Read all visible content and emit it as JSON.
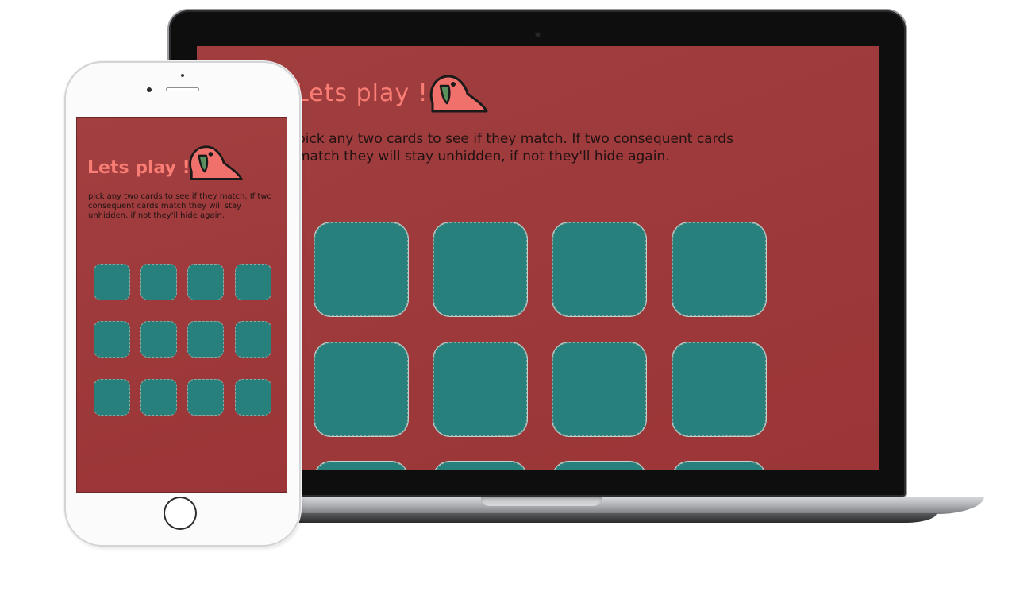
{
  "laptop": {
    "title": "Lets play !",
    "description": "pick any two cards to see if they match. If two consequent cards match they will stay unhidden, if not they'll hide again.",
    "cards_visible_rows": 3,
    "cards_per_row": 4
  },
  "phone": {
    "title": "Lets play !",
    "description": "pick any two cards to see if they match. If two consequent cards match they will stay unhidden, if not they'll hide again.",
    "cards_rows": 3,
    "cards_per_row": 4
  },
  "icons": {
    "mascot": "parrot-icon"
  },
  "colors": {
    "background": "#a03e3f",
    "title": "#f97d74",
    "card": "#27807c",
    "text": "#231212",
    "parrot_body": "#f0716c",
    "parrot_beak": "#5a8f5e"
  }
}
